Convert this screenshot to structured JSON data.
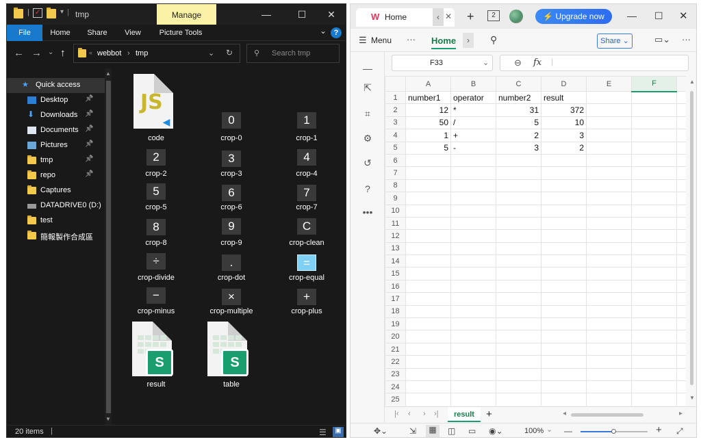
{
  "explorer": {
    "title": "tmp",
    "manage_label": "Manage",
    "ribbon_tabs": [
      "File",
      "Home",
      "Share",
      "View",
      "Picture Tools"
    ],
    "path": [
      "webbot",
      "tmp"
    ],
    "search_placeholder": "Search tmp",
    "nav_items": [
      {
        "label": "Quick access",
        "icon": "star-icon",
        "pinned": false
      },
      {
        "label": "Desktop",
        "icon": "desktop-icon",
        "pinned": true
      },
      {
        "label": "Downloads",
        "icon": "download-icon",
        "pinned": true
      },
      {
        "label": "Documents",
        "icon": "document-icon",
        "pinned": true
      },
      {
        "label": "Pictures",
        "icon": "pictures-icon",
        "pinned": true
      },
      {
        "label": "tmp",
        "icon": "folder-icon",
        "pinned": true
      },
      {
        "label": "repo",
        "icon": "folder-icon",
        "pinned": true
      },
      {
        "label": "Captures",
        "icon": "folder-icon",
        "pinned": false
      },
      {
        "label": "DATADRIVE0 (D:)",
        "icon": "drive-icon",
        "pinned": false
      },
      {
        "label": "test",
        "icon": "folder-icon",
        "pinned": false
      },
      {
        "label": "簡報製作合成區",
        "icon": "folder-icon",
        "pinned": false
      }
    ],
    "files": [
      {
        "name": "code",
        "glyph": "JS",
        "kind": "js"
      },
      {
        "name": "crop-0",
        "glyph": "0",
        "kind": "crop"
      },
      {
        "name": "crop-1",
        "glyph": "1",
        "kind": "crop"
      },
      {
        "name": "crop-2",
        "glyph": "2",
        "kind": "crop"
      },
      {
        "name": "crop-3",
        "glyph": "3",
        "kind": "crop"
      },
      {
        "name": "crop-4",
        "glyph": "4",
        "kind": "crop"
      },
      {
        "name": "crop-5",
        "glyph": "5",
        "kind": "crop"
      },
      {
        "name": "crop-6",
        "glyph": "6",
        "kind": "crop"
      },
      {
        "name": "crop-7",
        "glyph": "7",
        "kind": "crop"
      },
      {
        "name": "crop-8",
        "glyph": "8",
        "kind": "crop"
      },
      {
        "name": "crop-9",
        "glyph": "9",
        "kind": "crop"
      },
      {
        "name": "crop-clean",
        "glyph": "C",
        "kind": "crop"
      },
      {
        "name": "crop-divide",
        "glyph": "÷",
        "kind": "crop"
      },
      {
        "name": "crop-dot",
        "glyph": ".",
        "kind": "crop"
      },
      {
        "name": "crop-equal",
        "glyph": "=",
        "kind": "crop-equal"
      },
      {
        "name": "crop-minus",
        "glyph": "−",
        "kind": "crop"
      },
      {
        "name": "crop-multiple",
        "glyph": "×",
        "kind": "crop"
      },
      {
        "name": "crop-plus",
        "glyph": "+",
        "kind": "crop"
      },
      {
        "name": "result",
        "glyph": "S",
        "kind": "sheet"
      },
      {
        "name": "table",
        "glyph": "S",
        "kind": "sheet"
      }
    ],
    "status": "20 items"
  },
  "spreadsheet": {
    "tab_title": "Home",
    "tab_count": "2",
    "upgrade_label": "Upgrade now",
    "menu_label": "Menu",
    "home_label": "Home",
    "share_label": "Share",
    "cell_ref": "F33",
    "fx_label": "fx",
    "columns": [
      "A",
      "B",
      "C",
      "D",
      "E",
      "F"
    ],
    "rows": [
      [
        "number1",
        "operator",
        "number2",
        "result",
        "",
        ""
      ],
      [
        "12",
        "*",
        "31",
        "372",
        "",
        ""
      ],
      [
        "50",
        "/",
        "5",
        "10",
        "",
        ""
      ],
      [
        "1",
        "+",
        "2",
        "3",
        "",
        ""
      ],
      [
        "5",
        "-",
        "3",
        "2",
        "",
        ""
      ]
    ],
    "row_count": 25,
    "sheet_tab": "result",
    "zoom": "100%",
    "accent_color": "#1b9e6f"
  }
}
